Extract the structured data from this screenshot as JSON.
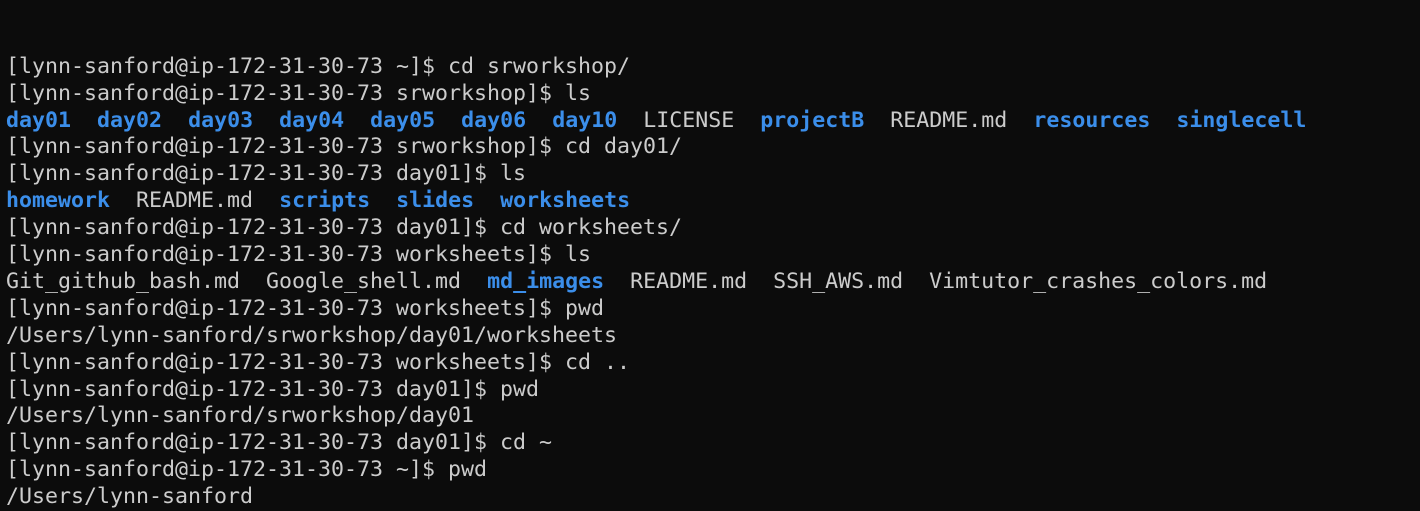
{
  "terminal": {
    "lines": [
      {
        "type": "cmd",
        "text": "[lynn-sanford@ip-172-31-30-73 ~]$ cd srworkshop/"
      },
      {
        "type": "cmd",
        "text": "[lynn-sanford@ip-172-31-30-73 srworkshop]$ ls"
      },
      {
        "type": "ls",
        "items": [
          {
            "name": "day01",
            "kind": "dir"
          },
          {
            "name": "day02",
            "kind": "dir"
          },
          {
            "name": "day03",
            "kind": "dir"
          },
          {
            "name": "day04",
            "kind": "dir"
          },
          {
            "name": "day05",
            "kind": "dir"
          },
          {
            "name": "day06",
            "kind": "dir"
          },
          {
            "name": "day10",
            "kind": "dir"
          },
          {
            "name": "LICENSE",
            "kind": "file"
          },
          {
            "name": "projectB",
            "kind": "dir"
          },
          {
            "name": "README.md",
            "kind": "file"
          },
          {
            "name": "resources",
            "kind": "dir"
          },
          {
            "name": "singlecell",
            "kind": "dir"
          }
        ]
      },
      {
        "type": "cmd",
        "text": "[lynn-sanford@ip-172-31-30-73 srworkshop]$ cd day01/"
      },
      {
        "type": "cmd",
        "text": "[lynn-sanford@ip-172-31-30-73 day01]$ ls"
      },
      {
        "type": "ls",
        "items": [
          {
            "name": "homework",
            "kind": "dir"
          },
          {
            "name": "README.md",
            "kind": "file"
          },
          {
            "name": "scripts",
            "kind": "dir"
          },
          {
            "name": "slides",
            "kind": "dir"
          },
          {
            "name": "worksheets",
            "kind": "dir"
          }
        ]
      },
      {
        "type": "cmd",
        "text": "[lynn-sanford@ip-172-31-30-73 day01]$ cd worksheets/"
      },
      {
        "type": "cmd",
        "text": "[lynn-sanford@ip-172-31-30-73 worksheets]$ ls"
      },
      {
        "type": "ls",
        "items": [
          {
            "name": "Git_github_bash.md",
            "kind": "file"
          },
          {
            "name": "Google_shell.md",
            "kind": "file"
          },
          {
            "name": "md_images",
            "kind": "dir"
          },
          {
            "name": "README.md",
            "kind": "file"
          },
          {
            "name": "SSH_AWS.md",
            "kind": "file"
          },
          {
            "name": "Vimtutor_crashes_colors.md",
            "kind": "file"
          }
        ]
      },
      {
        "type": "cmd",
        "text": "[lynn-sanford@ip-172-31-30-73 worksheets]$ pwd"
      },
      {
        "type": "out",
        "text": "/Users/lynn-sanford/srworkshop/day01/worksheets"
      },
      {
        "type": "cmd",
        "text": "[lynn-sanford@ip-172-31-30-73 worksheets]$ cd .."
      },
      {
        "type": "cmd",
        "text": "[lynn-sanford@ip-172-31-30-73 day01]$ pwd"
      },
      {
        "type": "out",
        "text": "/Users/lynn-sanford/srworkshop/day01"
      },
      {
        "type": "cmd",
        "text": "[lynn-sanford@ip-172-31-30-73 day01]$ cd ~"
      },
      {
        "type": "cmd",
        "text": "[lynn-sanford@ip-172-31-30-73 ~]$ pwd"
      },
      {
        "type": "out",
        "text": "/Users/lynn-sanford"
      }
    ]
  },
  "colors": {
    "background": "#0c0c0c",
    "text": "#cccccc",
    "directory": "#3b8eea"
  }
}
